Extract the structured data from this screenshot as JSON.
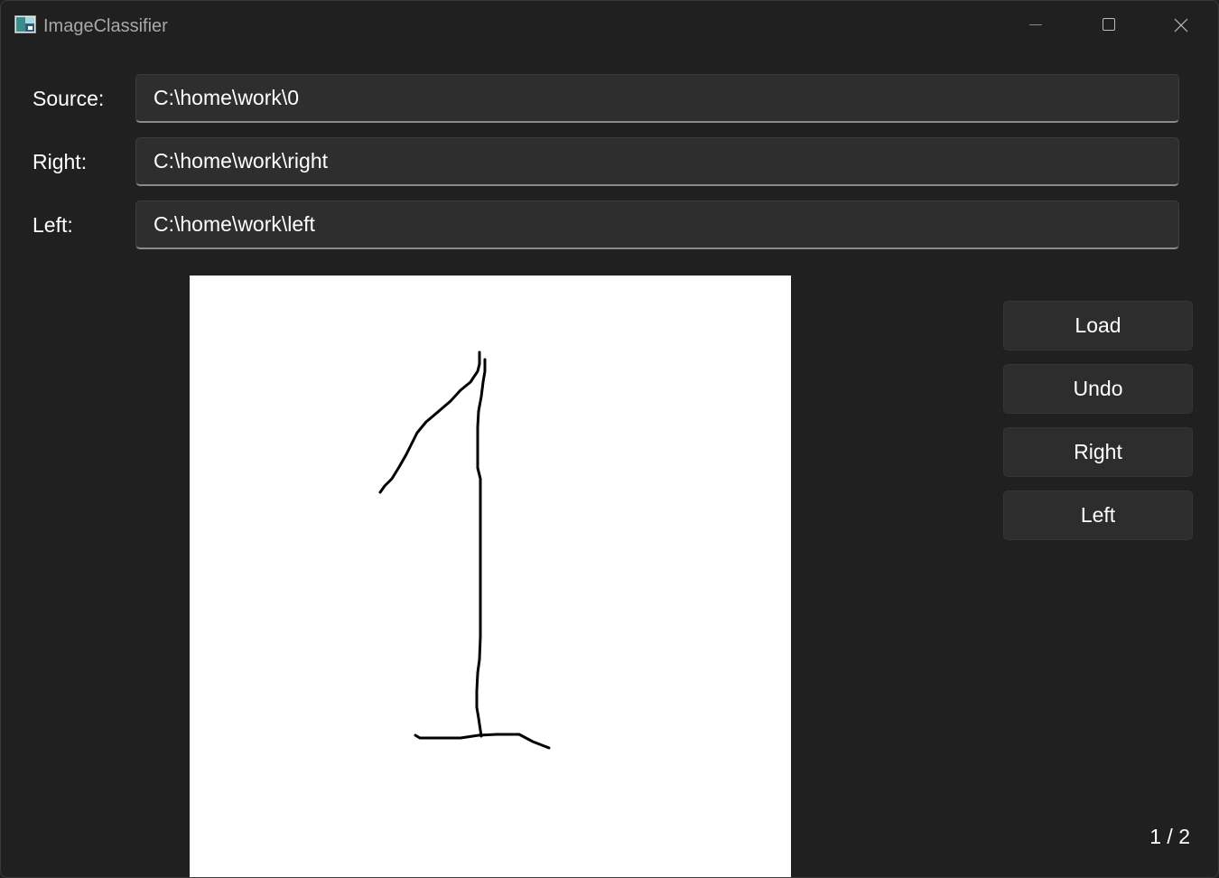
{
  "window": {
    "title": "ImageClassifier",
    "icon": "image-app-icon",
    "controls": {
      "minimize_icon": "minimize-icon",
      "maximize_icon": "maximize-icon",
      "close_icon": "close-icon"
    }
  },
  "form": {
    "source": {
      "label": "Source:",
      "value": "C:\\home\\work\\0"
    },
    "right": {
      "label": "Right:",
      "value": "C:\\home\\work\\right"
    },
    "left": {
      "label": "Left:",
      "value": "C:\\home\\work\\left"
    }
  },
  "buttons": {
    "load": "Load",
    "undo": "Undo",
    "right": "Right",
    "left": "Left"
  },
  "status": {
    "counter": "1 / 2"
  },
  "colors": {
    "background": "#202020",
    "field": "#2e2e2e",
    "button": "#2d2d2d",
    "canvas": "#ffffff",
    "text": "#ffffff",
    "title_text": "#a8a8a8"
  }
}
